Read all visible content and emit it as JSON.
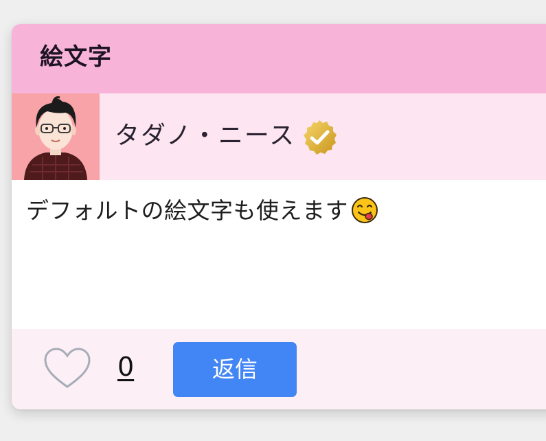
{
  "card": {
    "title": "絵文字"
  },
  "post": {
    "author": {
      "name": "タダノ・ニース",
      "verified": true,
      "avatar_icon": "person-with-glasses-avatar",
      "badge_icon": "gold-verified-check-icon"
    },
    "message": "デフォルトの絵文字も使えます",
    "emoji_icon": "face-savoring-food-emoji"
  },
  "actions": {
    "like_icon": "heart-outline-icon",
    "like_count": "0",
    "reply_label": "返信"
  },
  "colors": {
    "header": "#f8b3d8",
    "user_row": "#fde6f2",
    "footer": "#fdeff6",
    "avatar_bg": "#f8a3a8",
    "reply_button": "#4285f4",
    "heart_outline": "#a6adb8",
    "badge_gold": "#e4b43a"
  }
}
